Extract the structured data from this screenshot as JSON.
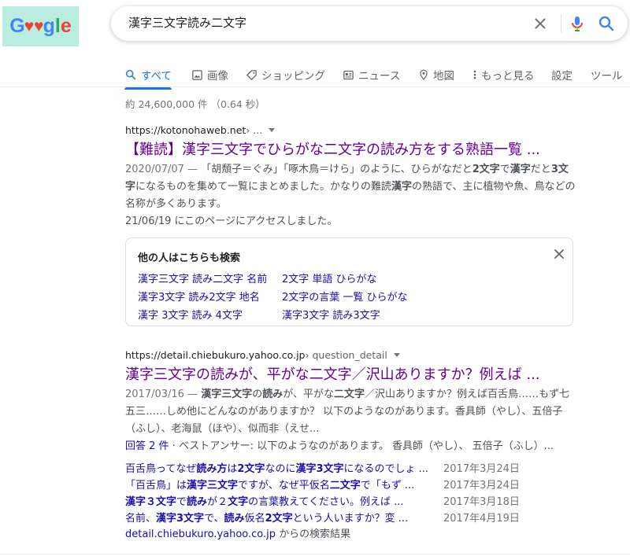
{
  "logo": {
    "text_g1": "G",
    "text_g2": "g",
    "text_l": "l",
    "text_e": "e"
  },
  "search": {
    "query": "漢字三文字読み二文字"
  },
  "tabs": [
    {
      "label": "すべて",
      "icon": "search-icon",
      "active": true
    },
    {
      "label": "画像",
      "icon": "image-icon"
    },
    {
      "label": "ショッピング",
      "icon": "tag-icon"
    },
    {
      "label": "ニュース",
      "icon": "news-icon"
    },
    {
      "label": "地図",
      "icon": "map-pin-icon"
    },
    {
      "label": "もっと見る",
      "icon": "more-vert-icon"
    },
    {
      "label": "設定"
    },
    {
      "label": "ツール"
    }
  ],
  "stats": "約 24,600,000 件 （0.64 秒）",
  "results": [
    {
      "url": "https://kotonohaweb.net",
      "crumb": " › ...",
      "title": "【難読】漢字三文字でひらがな二文字の読み方をする熟語一覧 ...",
      "date": "2020/07/07 — ",
      "snippet_parts": [
        "「胡頽子＝ぐみ」「啄木鳥＝けら」のように、ひらがなだと",
        "2文字",
        "で",
        "漢字",
        "だと",
        "3文字",
        "になるものを集めて一覧にまとめました。かなりの難読",
        "漢字",
        "の熟語で、主に植物や魚、鳥などの名称が多くあります。"
      ],
      "visited": "21/06/19 にこのページにアクセスしました。"
    },
    {
      "url": "https://detail.chiebukuro.yahoo.co.jp",
      "crumb": " › question_detail",
      "title": "漢字三文字の読みが、平がな二文字／沢山ありますか？例えば ...",
      "date": "2017/03/16 — ",
      "snippet_parts": [
        "漢字三文字",
        "の",
        "読み",
        "が、平がな",
        "二文字",
        "／沢山ありますか？例えば百舌鳥……もず七五三……しめ他にどんなのがありますか？ 以下のようなのがあります。香具師（やし）、五倍子（ふし）、老海鼠（ほや）、似而非（えせ..."
      ],
      "answers_count": "回答 2 件",
      "answers_text": " · ベストアンサー: 以下のようなのがあります。 香具師（やし）、 五倍子（ふし）..."
    }
  ],
  "people_also_search": {
    "heading": "他の人はこちらも検索",
    "links": [
      "漢字三文字 読み二文字 名前",
      "2文字 単語 ひらがな",
      "漢字3文字 読み2文字 地名",
      "2文字の言葉 一覧 ひらがな",
      "漢字 3文字 読み 4文字",
      "漢字3文字 読み3文字"
    ]
  },
  "related": [
    {
      "parts": [
        "百舌鳥ってなぜ",
        "読み方",
        "は",
        "2文字",
        "なのに",
        "漢字3文字",
        "になるのでしょ ..."
      ],
      "date": "2017年3月24日"
    },
    {
      "parts": [
        "「百舌鳥」は",
        "漢字三文字",
        "ですが、なぜ平仮名",
        "二文字",
        "で「もず ..."
      ],
      "date": "2017年3月24日"
    },
    {
      "parts": [
        "",
        "漢字３文字",
        "で",
        "読み",
        "が２",
        "文字",
        "の言葉教えてください。例えば ..."
      ],
      "date": "2017年3月18日"
    },
    {
      "parts": [
        "名前、",
        "漢字3文字",
        "で、",
        "読み",
        "仮名",
        "2文字",
        "という人いますか？変 ..."
      ],
      "date": "2017年4月19日"
    }
  ],
  "more_results": {
    "domain": "detail.chiebukuro.yahoo.co.jp",
    "rest": " からの検索結果"
  },
  "colors": {
    "accent": "#1a73e8",
    "visited_title": "#660099",
    "link": "#1a0dab",
    "logo_bg": "#b9ede0"
  }
}
